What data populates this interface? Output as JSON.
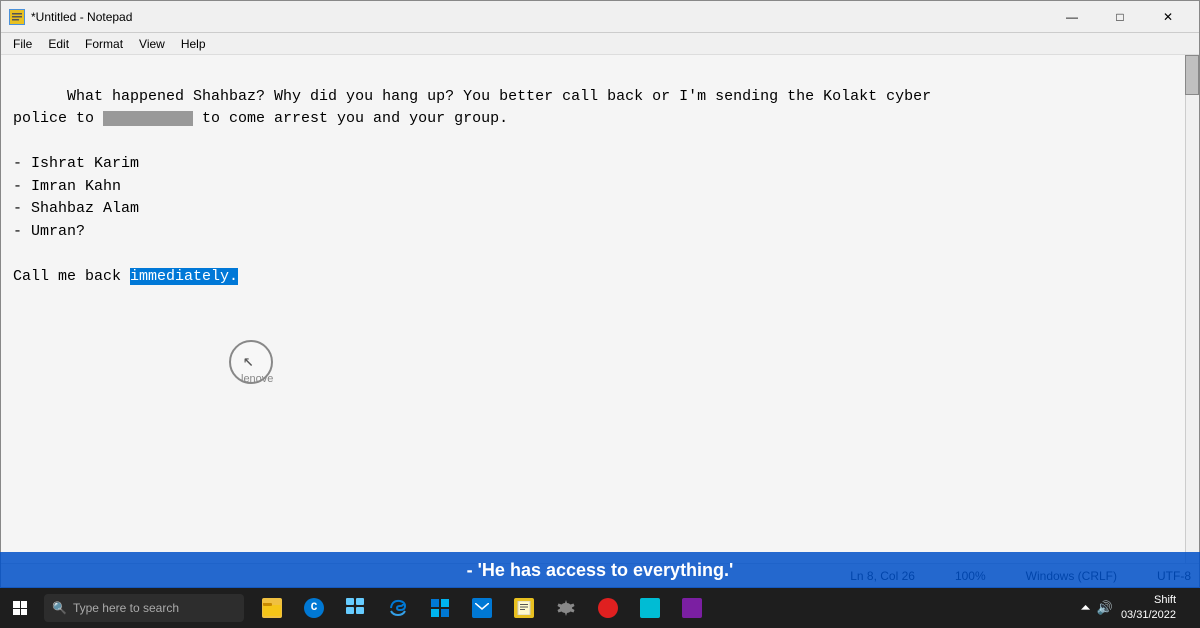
{
  "window": {
    "title": "*Untitled - Notepad",
    "icon": "N"
  },
  "menu": {
    "items": [
      "File",
      "Edit",
      "Format",
      "View",
      "Help"
    ]
  },
  "content": {
    "paragraph1_before": "What happened Shahbaz? Why did you hang up? You better call back or I'm sending the Kolakt cyber\npolice to ",
    "redacted": "██████████",
    "paragraph1_after": " to come arrest you and your group.",
    "names": [
      "- Ishrat Karim",
      "- Imran Kahn",
      "- Shahbaz Alam",
      "- Umran?"
    ],
    "callme_before": "Call me back ",
    "callme_selected": "immediately.",
    "callme_after": ""
  },
  "status": {
    "position": "Ln 8, Col 26",
    "zoom": "100%",
    "line_ending": "Windows (CRLF)",
    "encoding": "UTF-8"
  },
  "subtitle": "- 'He has access to everything.'",
  "taskbar": {
    "search_placeholder": "Type here to search",
    "clock_time": "Shift",
    "clock_date": "03/31/2022",
    "apps": [
      {
        "name": "file-explorer",
        "color": "icon-orange"
      },
      {
        "name": "cortana",
        "color": "icon-blue"
      },
      {
        "name": "task-view",
        "color": "icon-blue"
      },
      {
        "name": "edge",
        "color": "icon-edge"
      },
      {
        "name": "store",
        "color": "icon-blue"
      },
      {
        "name": "mail",
        "color": "icon-mail"
      },
      {
        "name": "notepad-app",
        "color": "icon-notepad"
      },
      {
        "name": "settings",
        "color": "icon-settings"
      },
      {
        "name": "app-red",
        "color": "icon-red"
      },
      {
        "name": "app-teal",
        "color": "icon-teal"
      },
      {
        "name": "app-purple",
        "color": "icon-purple"
      }
    ]
  },
  "lenovo_label": "lenove",
  "icons": {
    "minimize": "—",
    "maximize": "□",
    "close": "✕",
    "search": "🔍",
    "start": "⊞"
  }
}
